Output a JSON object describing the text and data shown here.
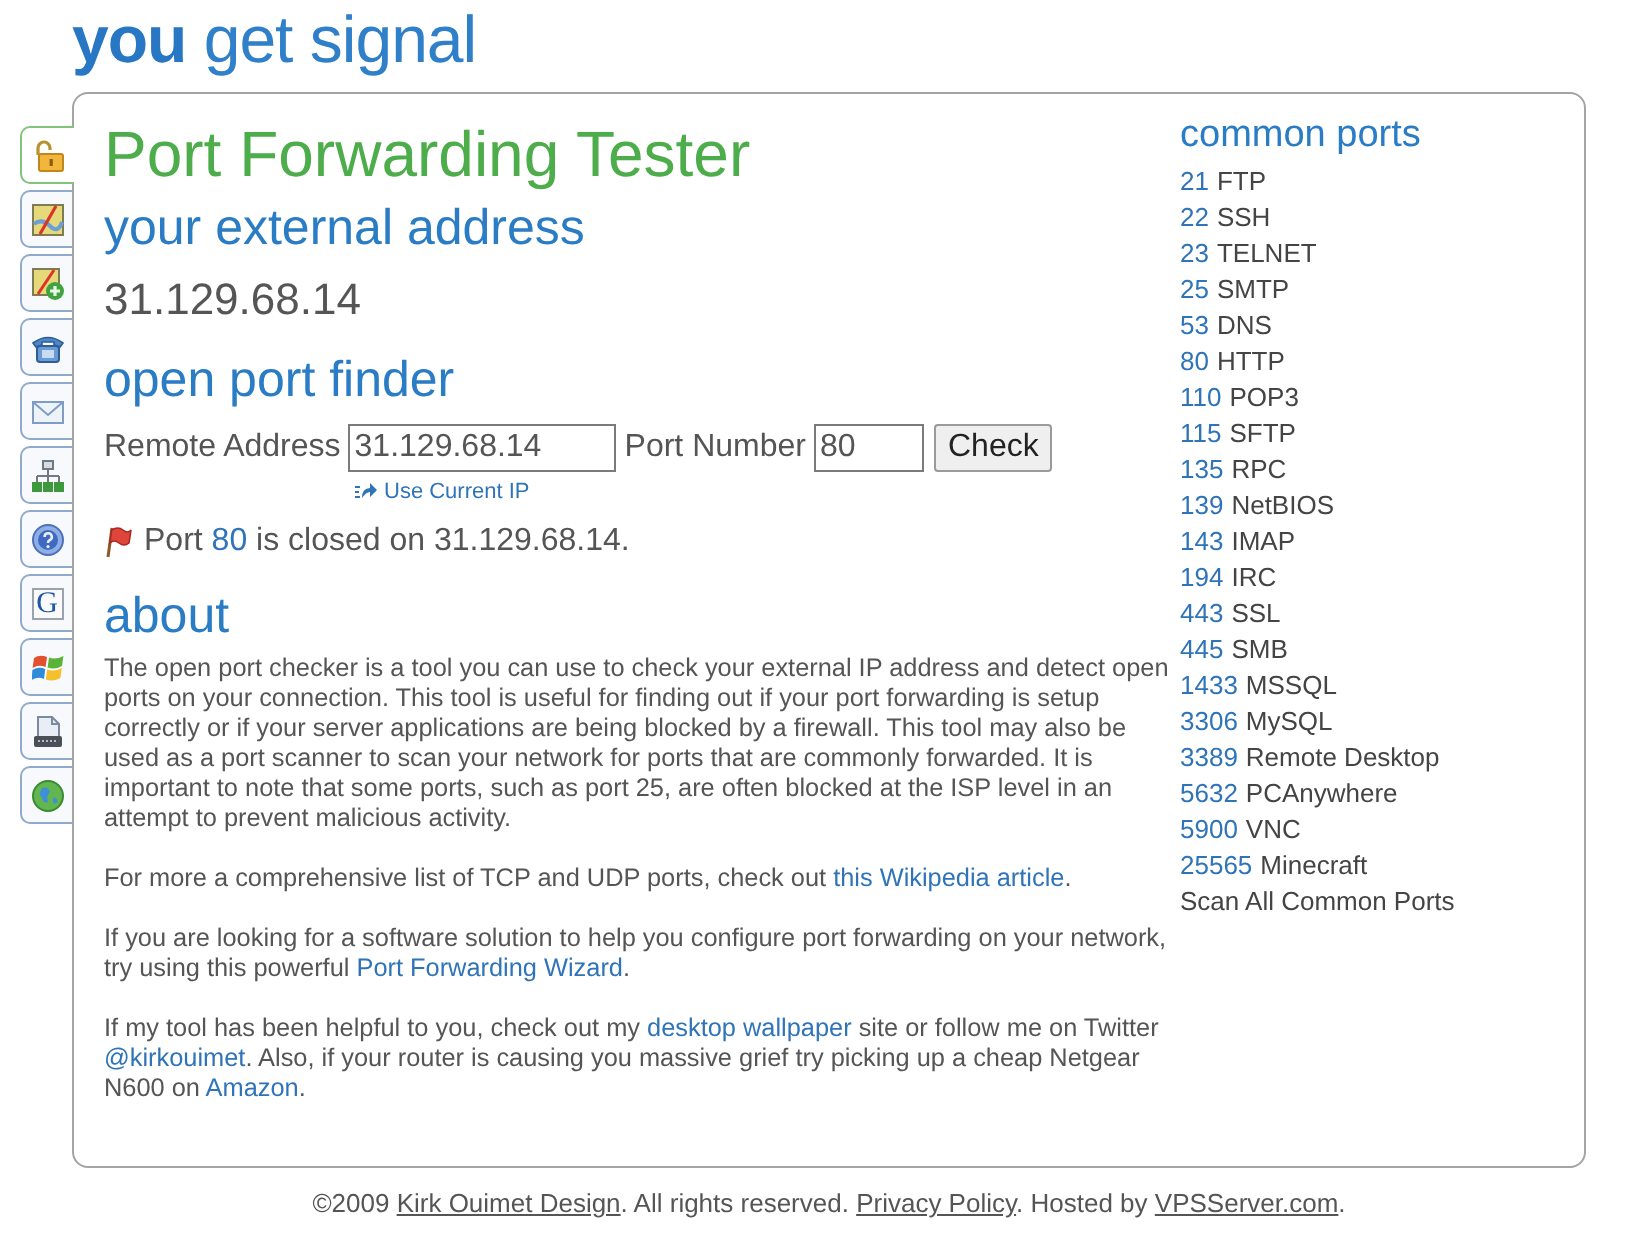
{
  "logo": "**you** get signal",
  "side_tabs": [
    {
      "kind": "lock",
      "selected": true
    },
    {
      "kind": "map",
      "selected": false
    },
    {
      "kind": "map-plus",
      "selected": false
    },
    {
      "kind": "phone",
      "selected": false
    },
    {
      "kind": "envelope",
      "selected": false
    },
    {
      "kind": "network",
      "selected": false
    },
    {
      "kind": "question",
      "selected": false
    },
    {
      "kind": "letter",
      "glyph": "G",
      "selected": false
    },
    {
      "kind": "four-color-flag",
      "selected": false
    },
    {
      "kind": "document",
      "selected": false
    },
    {
      "kind": "globe",
      "selected": false
    }
  ],
  "title": "Port Forwarding Tester",
  "external_address": {
    "heading": "your external address",
    "value": "31.129.68.14"
  },
  "port_finder": {
    "heading": "open port finder",
    "fields": [
      {
        "label": "Remote Address",
        "value": "31.129.68.14"
      },
      {
        "label": "Port Number",
        "value": "80"
      }
    ],
    "button": "Check",
    "use_current_ip": "Use Current IP",
    "result": {
      "open": false,
      "parts": [
        {
          "kind": "text",
          "text": "Port "
        },
        {
          "kind": "port",
          "text": "80"
        },
        {
          "kind": "text",
          "text": " is closed on 31.129.68.14."
        }
      ]
    }
  },
  "about": {
    "heading": "about",
    "paragraphs": [
      [
        {
          "kind": "text",
          "text": "The open port checker is a tool you can use to check your external IP address and detect open ports on your connection. This tool is useful for finding out if your port forwarding is setup correctly or if your server applications are being blocked by a firewall. This tool may also be used as a port scanner to scan your network for ports that are commonly forwarded. It is important to note that some ports, such as port 25, are often blocked at the ISP level in an attempt to prevent malicious activity."
        }
      ],
      [
        {
          "kind": "text",
          "text": "For more a comprehensive list of TCP and UDP ports, check out "
        },
        {
          "kind": "link",
          "text": "this Wikipedia article"
        },
        {
          "kind": "text",
          "text": "."
        }
      ],
      [
        {
          "kind": "text",
          "text": "If you are looking for a software solution to help you configure port forwarding on your network, try using this powerful "
        },
        {
          "kind": "link",
          "text": "Port Forwarding Wizard"
        },
        {
          "kind": "text",
          "text": "."
        }
      ],
      [
        {
          "kind": "text",
          "text": "If my tool has been helpful to you, check out my "
        },
        {
          "kind": "link",
          "text": "desktop wallpaper"
        },
        {
          "kind": "text",
          "text": " site or follow me on Twitter "
        },
        {
          "kind": "link",
          "text": "@kirkouimet"
        },
        {
          "kind": "text",
          "text": ". Also, if your router is causing you massive grief try picking up a cheap Netgear N600 on "
        },
        {
          "kind": "link",
          "text": "Amazon"
        },
        {
          "kind": "text",
          "text": "."
        }
      ]
    ]
  },
  "common_ports": {
    "heading": "common ports",
    "items": [
      {
        "number": "21",
        "name": "FTP"
      },
      {
        "number": "22",
        "name": "SSH"
      },
      {
        "number": "23",
        "name": "TELNET"
      },
      {
        "number": "25",
        "name": "SMTP"
      },
      {
        "number": "53",
        "name": "DNS"
      },
      {
        "number": "80",
        "name": "HTTP"
      },
      {
        "number": "110",
        "name": "POP3"
      },
      {
        "number": "115",
        "name": "SFTP"
      },
      {
        "number": "135",
        "name": "RPC"
      },
      {
        "number": "139",
        "name": "NetBIOS"
      },
      {
        "number": "143",
        "name": "IMAP"
      },
      {
        "number": "194",
        "name": "IRC"
      },
      {
        "number": "443",
        "name": "SSL"
      },
      {
        "number": "445",
        "name": "SMB"
      },
      {
        "number": "1433",
        "name": "MSSQL"
      },
      {
        "number": "3306",
        "name": "MySQL"
      },
      {
        "number": "3389",
        "name": "Remote Desktop"
      },
      {
        "number": "5632",
        "name": "PCAnywhere"
      },
      {
        "number": "5900",
        "name": "VNC"
      },
      {
        "number": "25565",
        "name": "Minecraft"
      }
    ],
    "scan_all": "Scan All Common Ports"
  },
  "footer": [
    {
      "kind": "text",
      "text": "©2009 "
    },
    {
      "kind": "link",
      "text": "Kirk Ouimet Design"
    },
    {
      "kind": "text",
      "text": ". All rights reserved. "
    },
    {
      "kind": "link",
      "text": "Privacy Policy"
    },
    {
      "kind": "text",
      "text": ". Hosted by "
    },
    {
      "kind": "link",
      "text": "VPSServer.com"
    },
    {
      "kind": "text",
      "text": "."
    }
  ]
}
